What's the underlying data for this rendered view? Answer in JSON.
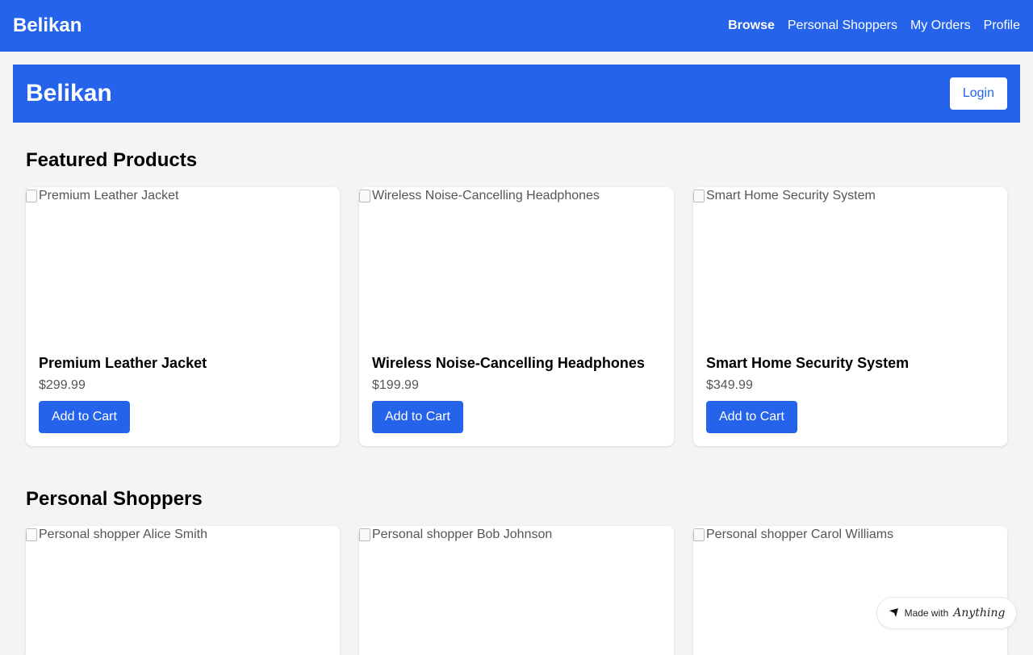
{
  "nav": {
    "brand": "Belikan",
    "links": [
      "Browse",
      "Personal Shoppers",
      "My Orders",
      "Profile"
    ]
  },
  "hero": {
    "title": "Belikan",
    "login_label": "Login"
  },
  "featured": {
    "title": "Featured Products",
    "products": [
      {
        "image_alt": "Premium Leather Jacket",
        "name": "Premium Leather Jacket",
        "price": "$299.99",
        "button": "Add to Cart"
      },
      {
        "image_alt": "Wireless Noise-Cancelling Headphones",
        "name": "Wireless Noise-Cancelling Headphones",
        "price": "$199.99",
        "button": "Add to Cart"
      },
      {
        "image_alt": "Smart Home Security System",
        "name": "Smart Home Security System",
        "price": "$349.99",
        "button": "Add to Cart"
      }
    ]
  },
  "shoppers": {
    "title": "Personal Shoppers",
    "items": [
      {
        "image_alt": "Personal shopper Alice Smith"
      },
      {
        "image_alt": "Personal shopper Bob Johnson"
      },
      {
        "image_alt": "Personal shopper Carol Williams"
      }
    ]
  },
  "badge": {
    "prefix": "Made with",
    "brand": "Anything"
  },
  "colors": {
    "primary": "#2563eb",
    "background": "#f3f4f6"
  }
}
